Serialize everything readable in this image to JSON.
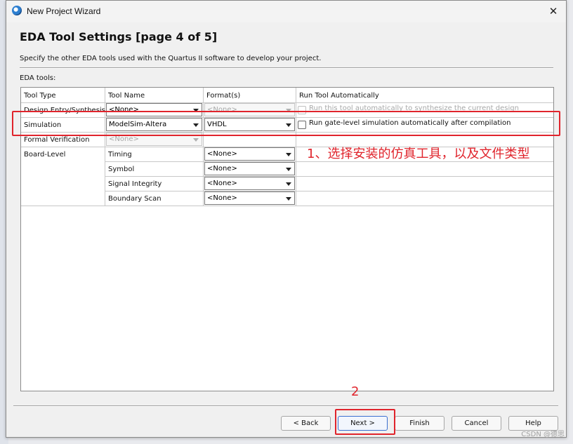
{
  "window": {
    "title": "New Project Wizard",
    "close_glyph": "✕",
    "icon": "app-icon"
  },
  "page": {
    "title": "EDA Tool Settings [page 4 of 5]",
    "subtitle": "Specify the other EDA tools used with the Quartus II software to develop your project.",
    "eda_tools_label": "EDA tools:"
  },
  "table": {
    "headers": [
      "Tool Type",
      "Tool Name",
      "Format(s)",
      "Run Tool Automatically"
    ],
    "rows": [
      {
        "type": "Design Entry/Synthesis",
        "tool": "<None>",
        "format": "<None>",
        "run": "Run this tool automatically to synthesize the current design",
        "checked": false
      },
      {
        "type": "Simulation",
        "tool": "ModelSim-Altera",
        "format": "VHDL",
        "run": "Run gate-level simulation automatically after compilation",
        "checked": false
      },
      {
        "type": "Formal Verification",
        "tool": "<None>",
        "format": "",
        "run": ""
      },
      {
        "type": "Board-Level",
        "tool": "Timing",
        "format": "<None>",
        "run": ""
      },
      {
        "type": "",
        "tool": "Symbol",
        "format": "<None>",
        "run": ""
      },
      {
        "type": "",
        "tool": "Signal Integrity",
        "format": "<None>",
        "run": ""
      },
      {
        "type": "",
        "tool": "Boundary Scan",
        "format": "<None>",
        "run": ""
      }
    ]
  },
  "annotations": {
    "note1": "1、选择安装的仿真工具，以及文件类型",
    "note2": "2",
    "color": "#e0242c"
  },
  "buttons": {
    "back": "< Back",
    "next": "Next >",
    "finish": "Finish",
    "cancel": "Cancel",
    "help": "Help"
  },
  "watermark": "CSDN @德思"
}
